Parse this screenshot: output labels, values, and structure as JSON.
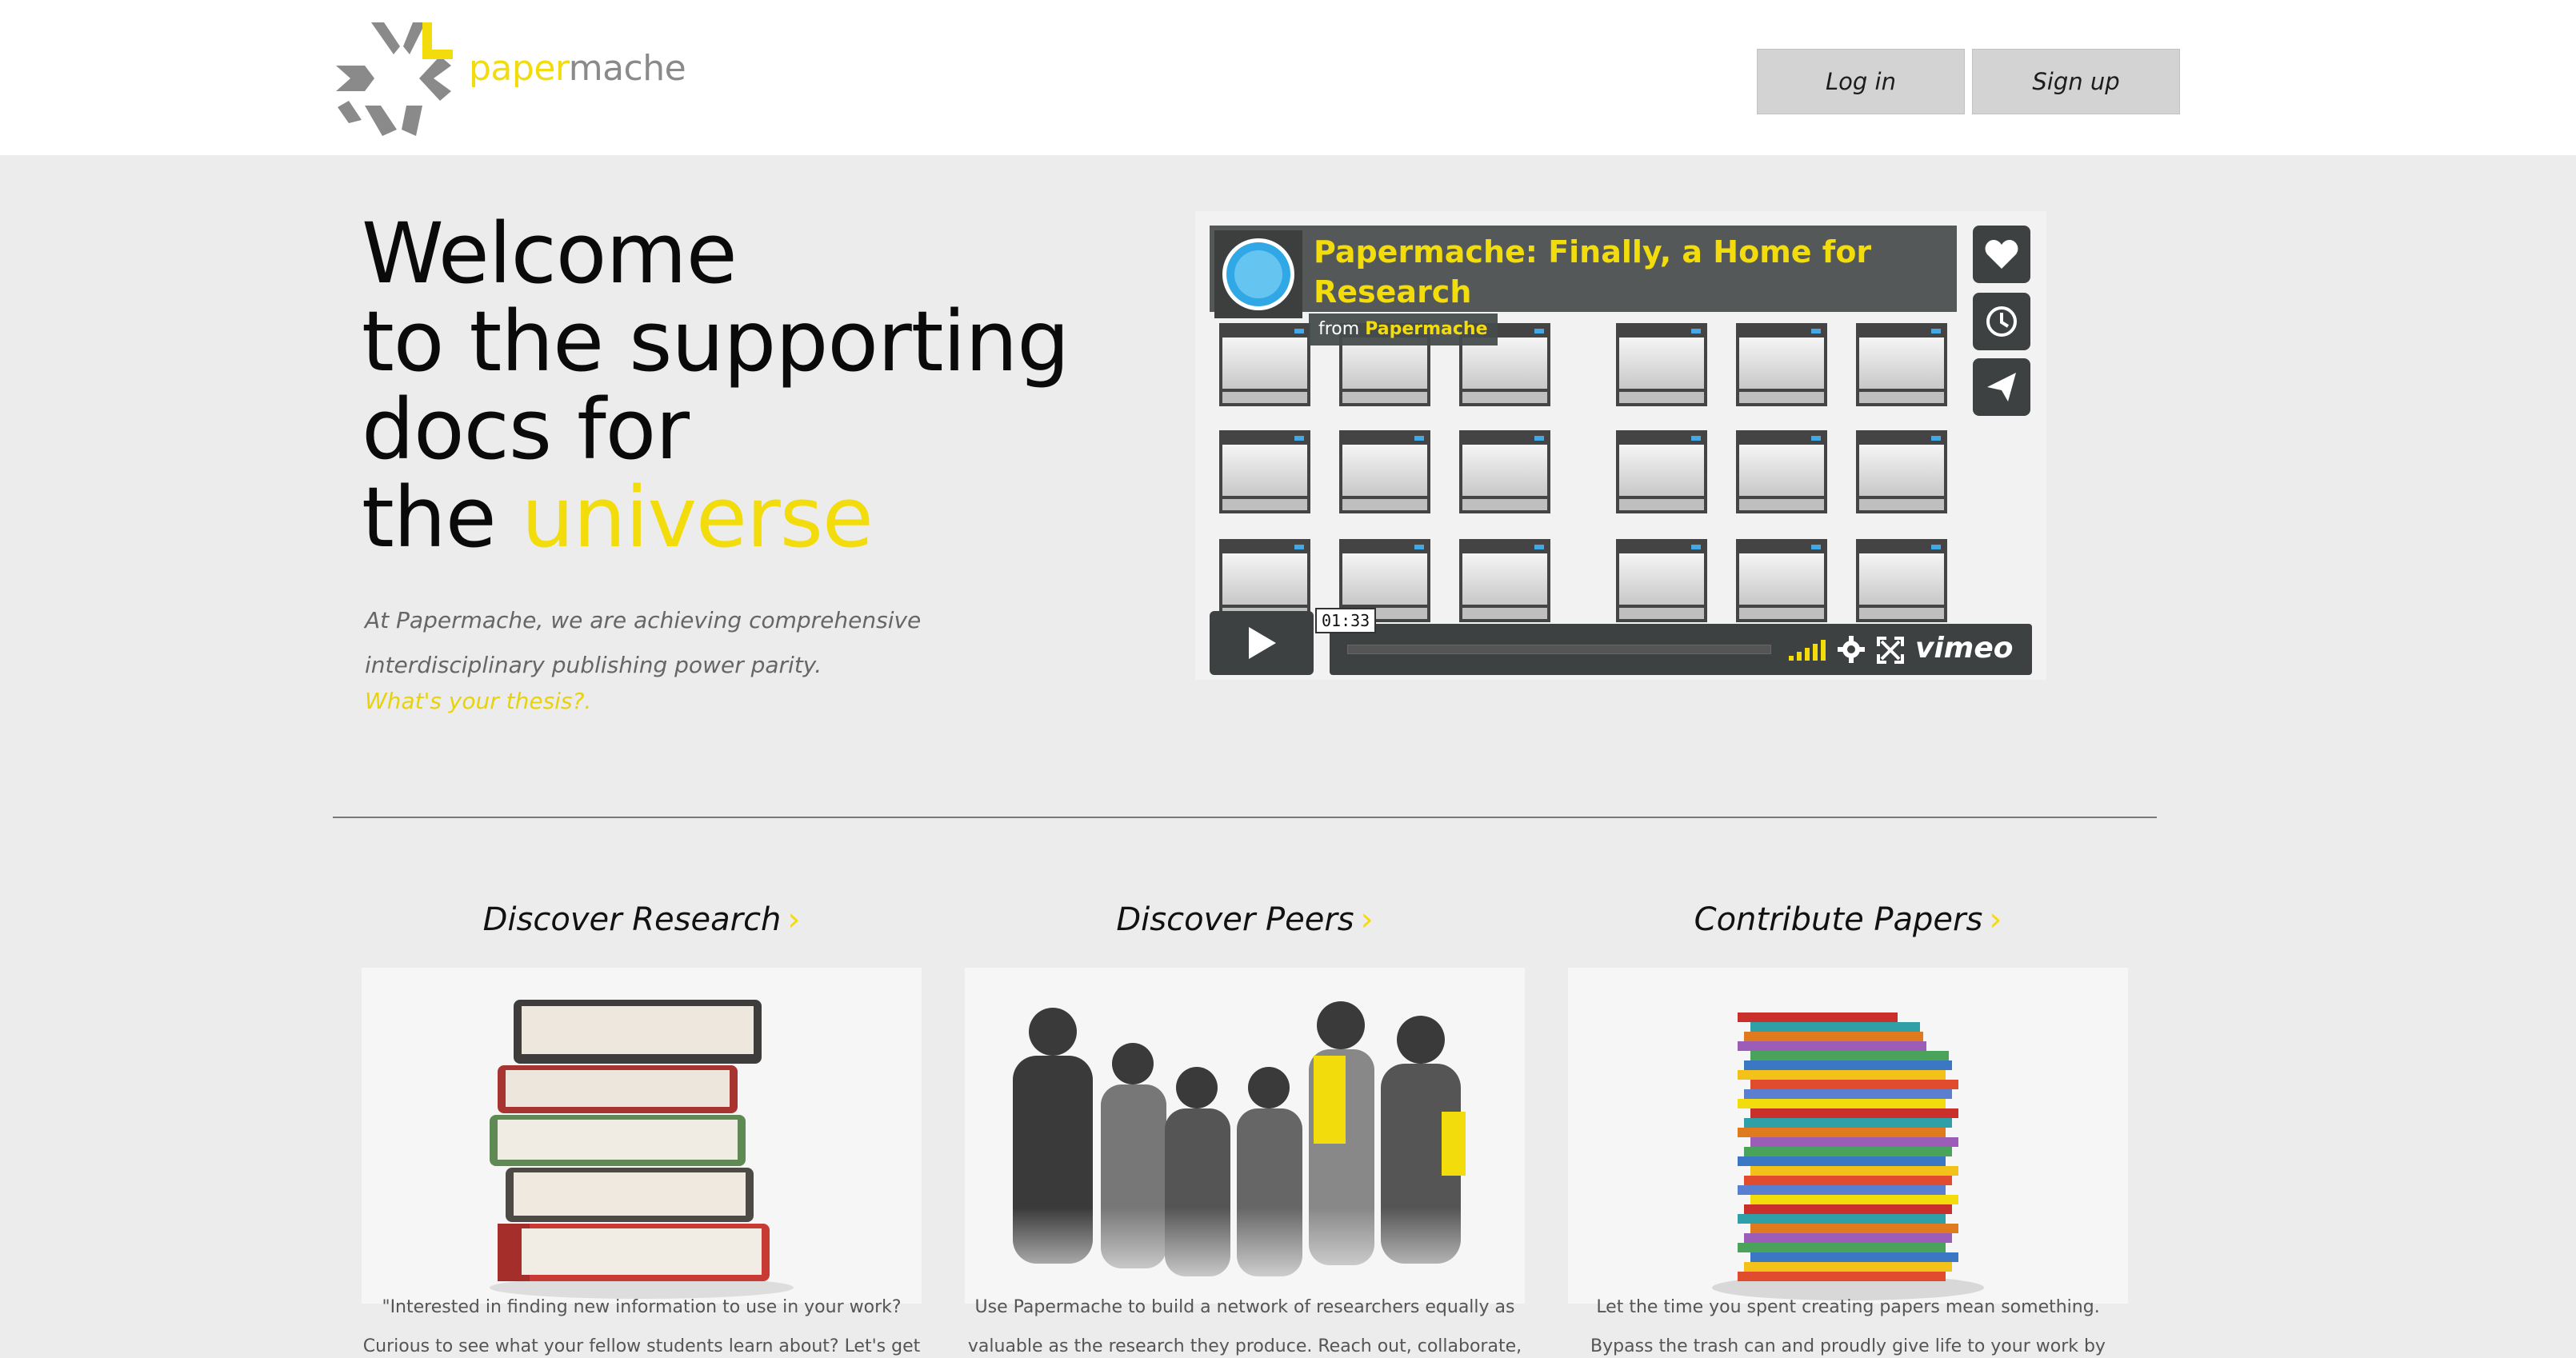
{
  "brand": {
    "name_part1": "paper",
    "name_part2": "mache",
    "accent_color": "#f2dc0b"
  },
  "header": {
    "login_label": "Log in",
    "signup_label": "Sign up"
  },
  "hero": {
    "line1": "Welcome",
    "line2": "to the supporting",
    "line3": "docs for",
    "line4_prefix": "the ",
    "line4_accent": "universe",
    "description": "At Papermache, we are achieving comprehensive interdisciplinary publishing power parity.",
    "cta": "What's your thesis?."
  },
  "video": {
    "title": "Papermache: Finally, a Home for Research",
    "from_label": "from",
    "from_name": "Papermache",
    "time": "01:33",
    "brand": "vimeo",
    "side_icons": [
      "heart-icon",
      "clock-icon",
      "send-icon"
    ]
  },
  "features": [
    {
      "heading": "Discover Research",
      "image": "stack-of-books",
      "text": "\"Interested in finding new information to use in your work? Curious to see what your fellow students learn about? Let's get started."
    },
    {
      "heading": "Discover Peers",
      "image": "group-of-people",
      "text": "Use Papermache to build a network of researchers equally as valuable as the research they produce. Reach out, collaborate, and"
    },
    {
      "heading": "Contribute Papers",
      "image": "stack-of-folders",
      "text": "Let the time you spent creating papers mean something. Bypass the trash can and proudly give life to your work by enlightening your"
    }
  ]
}
